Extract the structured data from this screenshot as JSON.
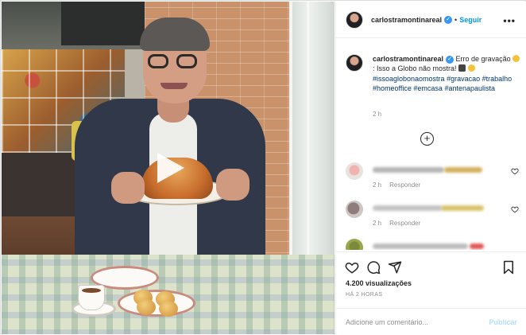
{
  "post": {
    "username": "carlostramontinareal",
    "follow_label": "Seguir",
    "separator": "•",
    "more_label": "•••",
    "caption": {
      "username": "carlostramontinareal",
      "text_1": " Erro de gravação ",
      "text_2": ": Isso a Globo não mostra! ",
      "tags": [
        "#issoaglobonaomostra",
        "#gravacao",
        "#trabalho",
        "#homeoffice",
        "#emcasa",
        "#antenapaulista"
      ],
      "time": "2 h"
    },
    "load_more_label": "+",
    "comments": [
      {
        "time": "2 h",
        "reply_label": "Responder"
      },
      {
        "time": "2 h",
        "reply_label": "Responder"
      },
      {
        "time": "",
        "reply_label": ""
      }
    ],
    "views": "4.200 visualizações",
    "age": "HÁ 2 HORAS",
    "add_comment_placeholder": "Adicione um comentário...",
    "publish_label": "Publicar"
  },
  "icons": {
    "verified": "verified-badge",
    "more": "more-options-icon",
    "like": "heart-icon",
    "comment": "comment-icon",
    "share": "share-icon",
    "save": "bookmark-icon",
    "play": "play-icon"
  },
  "colors": {
    "accent": "#0095f6",
    "hashtag": "#00376b",
    "muted": "#8e8e8e",
    "publish_disabled": "#b2dffc"
  }
}
